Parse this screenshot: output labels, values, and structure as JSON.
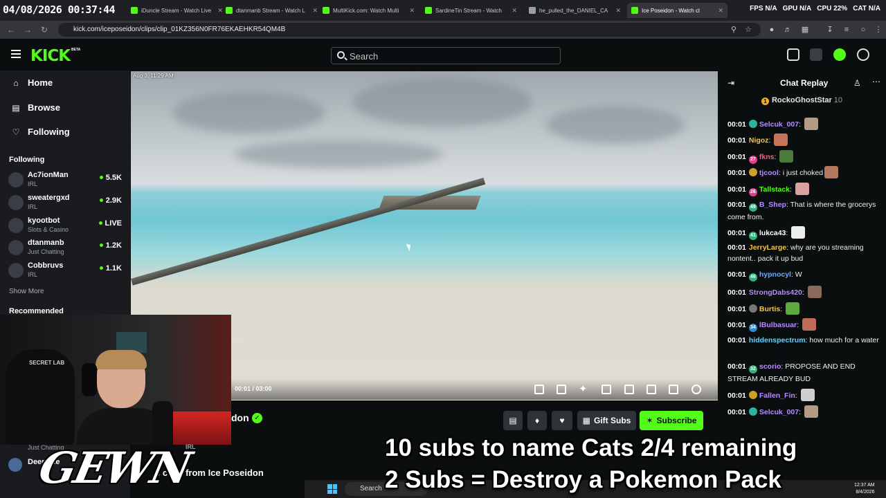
{
  "overlay_clock": "04/08/2026 00:37:44",
  "browser": {
    "tabs": [
      {
        "title": "iDuncle Stream - Watch Live",
        "color": "#53fc18"
      },
      {
        "title": "dtanmanb Stream - Watch L",
        "color": "#53fc18"
      },
      {
        "title": "MultiKick.com: Watch Multi",
        "color": "#53fc18"
      },
      {
        "title": "SardineTin Stream - Watch",
        "color": "#53fc18"
      },
      {
        "title": "he_pulled_the_DANIEL_CA",
        "color": "#9aa0a6"
      },
      {
        "title": "Ice Poseidon - Watch cl",
        "color": "#53fc18"
      }
    ],
    "stats": [
      "FPS N/A",
      "GPU N/A",
      "CPU 22%",
      "CAT N/A"
    ],
    "url": "kick.com/iceposeidon/clips/clip_01KZ356N0FR76EKAEHKR54QM4B"
  },
  "header": {
    "logo": "KICK",
    "logo_badge": "BETA",
    "search_placeholder": "Search"
  },
  "sidebar": {
    "nav": [
      {
        "label": "Home",
        "icon": "home-icon"
      },
      {
        "label": "Browse",
        "icon": "browse-icon"
      },
      {
        "label": "Following",
        "icon": "heart-icon"
      }
    ],
    "following_heading": "Following",
    "following": [
      {
        "name": "Ac7ionMan",
        "category": "IRL",
        "viewers": "5.5K"
      },
      {
        "name": "sweatergxd",
        "category": "IRL",
        "viewers": "2.9K"
      },
      {
        "name": "kyootbot",
        "category": "Slots & Casino",
        "viewers": "LIVE"
      },
      {
        "name": "dtanmanb",
        "category": "Just Chatting",
        "viewers": "1.2K"
      },
      {
        "name": "Cobbruvs",
        "category": "IRL",
        "viewers": "1.1K"
      }
    ],
    "show_more": "Show More",
    "recommended_heading": "Recommended",
    "deen_category": "Just Chatting",
    "deen_name": "DeenThe",
    "irl_tag": "IRL"
  },
  "video": {
    "clip_date": "Aug 3, 11:29 AM",
    "time": "00:01 / 03:00",
    "overlay_chat_1": "me from.",
    "overlay_chat_2": "ntent.. pack it up bud"
  },
  "webcam": {
    "chair_text": "SECRET LAB"
  },
  "channel": {
    "name": "don",
    "more_clips": "e clips from Ice Poseidon",
    "gift_label": "Gift Subs",
    "subscribe_label": "Subscribe"
  },
  "chat": {
    "title": "Chat Replay",
    "pinned": {
      "name": "RockoGhostStar",
      "count": "10"
    },
    "messages": [
      {
        "ts": "00:01",
        "badge": "",
        "badge_color": "#2bb5a0",
        "user": "Selcuk_007",
        "color": "#b58cff",
        "text": "",
        "emote": "#b39a86"
      },
      {
        "ts": "00:01",
        "badge": "",
        "badge_color": "",
        "user": "Nigoz",
        "color": "#f5c542",
        "text": "",
        "emote": "#c7735a"
      },
      {
        "ts": "00:01",
        "badge": "27",
        "badge_color": "#e0418f",
        "user": "fkns",
        "color": "#ff5a7a",
        "text": "",
        "emote": "#4d7a3a"
      },
      {
        "ts": "00:01",
        "badge": "",
        "badge_color": "#c9a227",
        "user": "tjcool",
        "color": "#b58cff",
        "text": "i just choked",
        "emote": "#b4765d"
      },
      {
        "ts": "00:01",
        "badge": "26",
        "badge_color": "#e0418f",
        "user": "Tallstack",
        "color": "#53fc18",
        "text": "",
        "emote": "#d9a0a0"
      },
      {
        "ts": "00:01",
        "badge": "49",
        "badge_color": "#2bb57a",
        "user": "B_Shep",
        "color": "#b58cff",
        "text": "That is where the grocerys come from.",
        "emote": ""
      },
      {
        "ts": "00:01",
        "badge": "41",
        "badge_color": "#2bb57a",
        "user": "lukca43",
        "color": "#ffffff",
        "text": "",
        "emote": "#eeeeee"
      },
      {
        "ts": "00:01",
        "badge": "",
        "badge_color": "",
        "user": "JerryLarge",
        "color": "#f5c542",
        "text": "why are you streaming nontent.. pack it up bud",
        "emote": ""
      },
      {
        "ts": "00:01",
        "badge": "46",
        "badge_color": "#2bb57a",
        "user": "hypnocyl",
        "color": "#6aa9ff",
        "text": "W",
        "emote": ""
      },
      {
        "ts": "00:01",
        "badge": "",
        "badge_color": "",
        "user": "StrongDabs420",
        "color": "#b58cff",
        "text": "",
        "emote": "#8a6a5a"
      },
      {
        "ts": "00:01",
        "badge": "",
        "badge_color": "#777777",
        "user": "Burtis",
        "color": "#f5c542",
        "text": "",
        "emote": "#5caa3c"
      },
      {
        "ts": "00:01",
        "badge": "34",
        "badge_color": "#2b8fd5",
        "user": "lBulbasuar",
        "color": "#b58cff",
        "text": "",
        "emote": "#c26a5a"
      },
      {
        "ts": "00:01",
        "badge": "",
        "badge_color": "",
        "user": "hiddenspectrum",
        "color": "#6ad0ff",
        "text": "how much for a water",
        "emote": ""
      },
      {
        "ts": "00:01",
        "badge": "32",
        "badge_color": "#2bb57a",
        "user": "scorio",
        "color": "#b58cff",
        "text": "PROPOSE AND END STREAM ALREADY BUD",
        "emote": ""
      },
      {
        "ts": "00:01",
        "badge": "",
        "badge_color": "#c9a227",
        "user": "Fallen_Fin",
        "color": "#b58cff",
        "text": "",
        "emote": "#cfcfcf"
      },
      {
        "ts": "00:01",
        "badge": "",
        "badge_color": "#2bb5a0",
        "user": "Selcuk_007",
        "color": "#b58cff",
        "text": "",
        "emote": "#b39a86"
      }
    ]
  },
  "overlay": {
    "line1": "10 subs to name Cats 2/4 remaining",
    "line2": "2 Subs = Destroy a Pokemon Pack",
    "gewn": "GEWN"
  },
  "taskbar": {
    "search": "Search",
    "time": "12:37 AM",
    "date": "8/4/2026"
  }
}
